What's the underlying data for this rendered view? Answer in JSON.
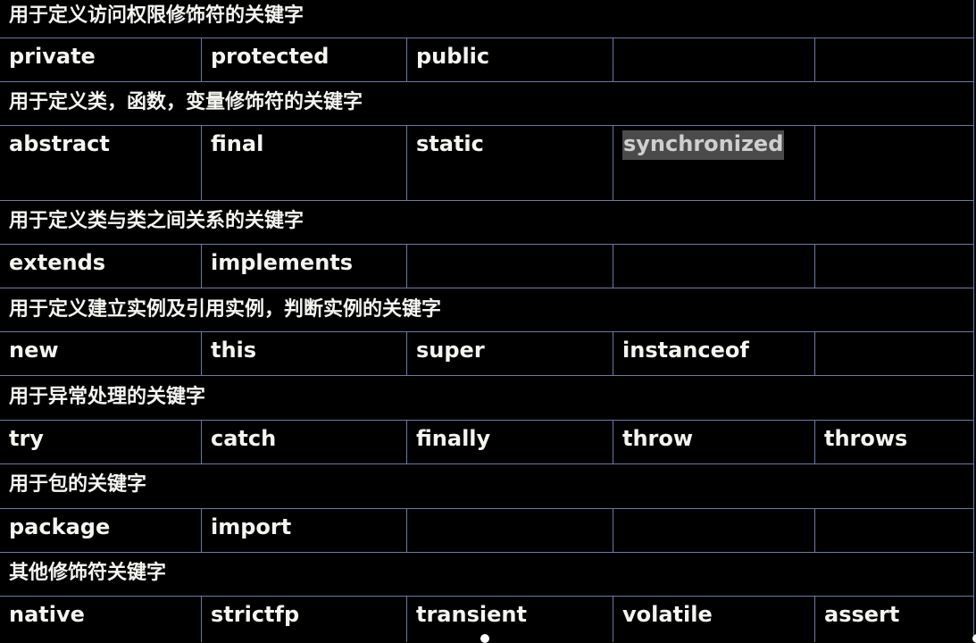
{
  "sections": [
    {
      "heading": "用于定义访问权限修饰符的关键字",
      "keywords": [
        "private",
        "protected",
        "public",
        "",
        ""
      ]
    },
    {
      "heading": "用于定义类，函数，变量修饰符的关键字",
      "keywords": [
        "abstract",
        "final",
        "static",
        "synchronized",
        ""
      ],
      "highlighted_keyword": "synchronized"
    },
    {
      "heading": "用于定义类与类之间关系的关键字",
      "keywords": [
        "extends",
        "implements",
        "",
        "",
        ""
      ]
    },
    {
      "heading": "用于定义建立实例及引用实例，判断实例的关键字",
      "keywords": [
        "new",
        "this",
        "super",
        "instanceof",
        ""
      ]
    },
    {
      "heading": "用于异常处理的关键字",
      "keywords": [
        "try",
        "catch",
        "finally",
        "throw",
        "throws"
      ]
    },
    {
      "heading": "用于包的关键字",
      "keywords": [
        "package",
        "import",
        "",
        "",
        ""
      ]
    },
    {
      "heading": "其他修饰符关键字",
      "keywords": [
        "native",
        "strictfp",
        "transient",
        "volatile",
        "assert"
      ]
    }
  ],
  "colors": {
    "background": "#000000",
    "text": "#f4f4f0",
    "grid_line": "#6c7aa6",
    "selection_bg": "#4b4b4b"
  }
}
